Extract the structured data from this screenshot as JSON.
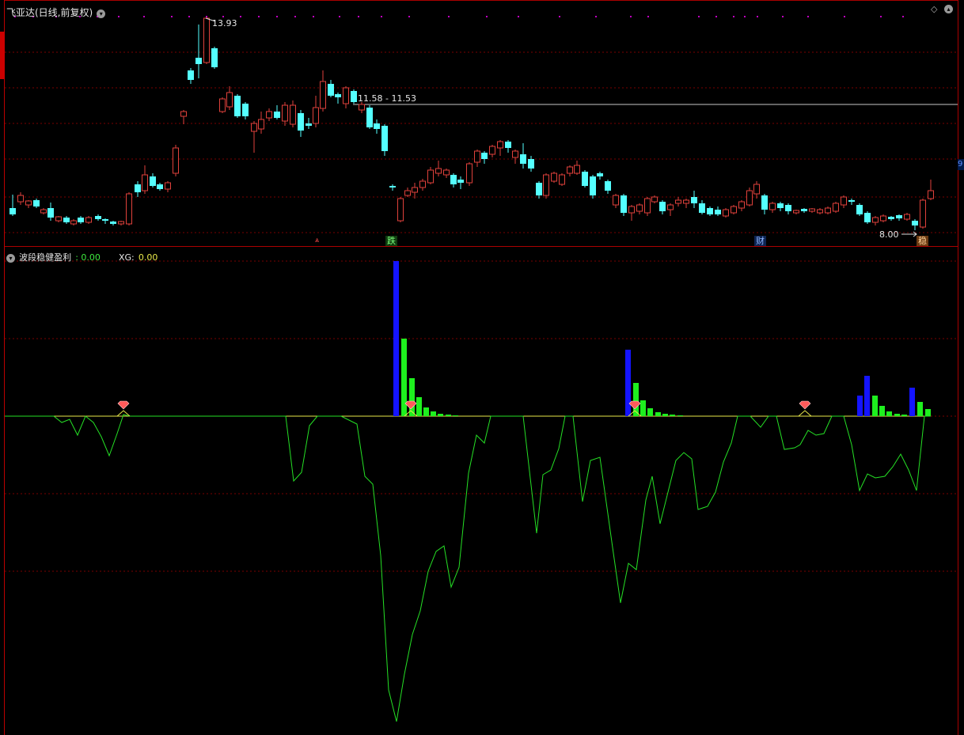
{
  "top": {
    "title": "飞亚达(日线,前复权)",
    "high_label": "13.93",
    "range_label": "11.58 - 11.53",
    "low_label": "8.00",
    "right_tag": "9",
    "markers": [
      "跌",
      "财",
      "稳"
    ],
    "up_arrow": "⩓"
  },
  "indicator": {
    "name": "波段稳健盈利",
    "value": "0.00",
    "xg_label": "XG:",
    "xg_value": "0.00"
  },
  "icons": {
    "dropdown": "chevron-down-icon",
    "diamond": "diamond-icon",
    "expand": "expand-icon",
    "gem": "gem-icon"
  },
  "colors": {
    "up": "#e0413b",
    "down": "#54ffff",
    "panel_border": "#a00000",
    "indicator_line": "#25e025",
    "indicator_zero": "#e8e84a",
    "bar_blue": "#1414ff",
    "bar_green": "#1ef01e",
    "gem": "#ff5a5a"
  }
}
